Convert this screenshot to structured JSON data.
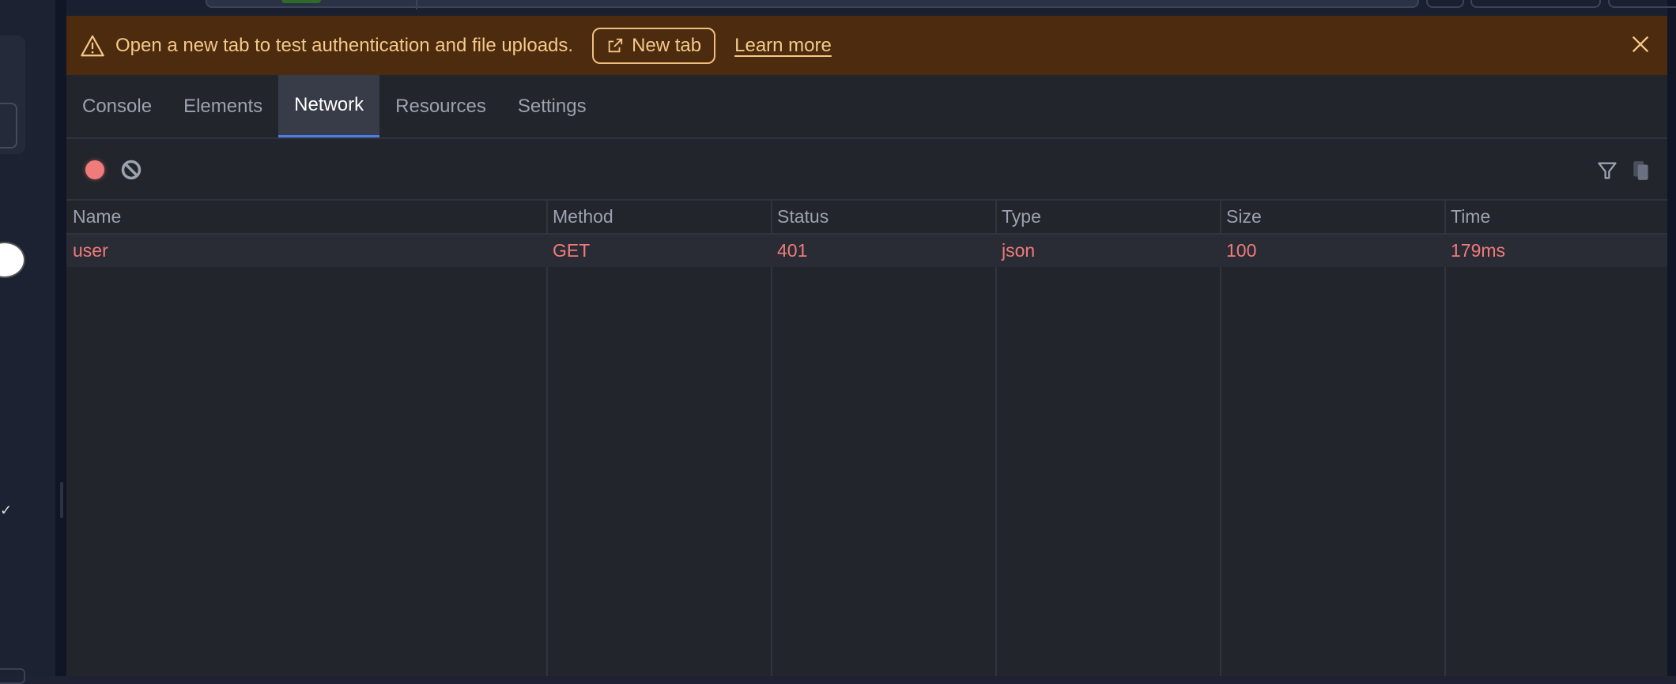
{
  "banner": {
    "message": "Open a new tab to test authentication and file uploads.",
    "new_tab_label": "New tab",
    "learn_more_label": "Learn more"
  },
  "tabs": [
    {
      "label": "Console",
      "active": false
    },
    {
      "label": "Elements",
      "active": false
    },
    {
      "label": "Network",
      "active": true
    },
    {
      "label": "Resources",
      "active": false
    },
    {
      "label": "Settings",
      "active": false
    }
  ],
  "network": {
    "columns": [
      "Name",
      "Method",
      "Status",
      "Type",
      "Size",
      "Time"
    ],
    "rows": [
      {
        "name": "user",
        "method": "GET",
        "status": "401",
        "type": "json",
        "size": "100",
        "time": "179ms"
      }
    ]
  },
  "colors": {
    "banner_bg": "#4d2b0e",
    "banner_text": "#f5c98a",
    "error_text": "#f07b7b",
    "active_tab_underline": "#4d7ee8"
  }
}
